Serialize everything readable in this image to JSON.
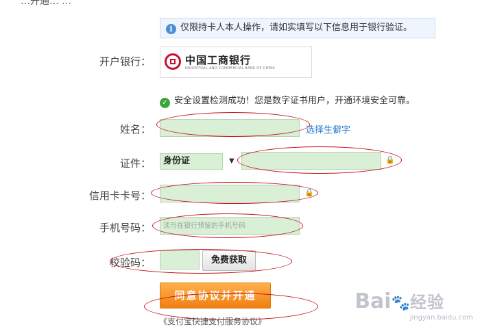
{
  "header_cut": {
    "text": "…开通…",
    "link": "…"
  },
  "notice": {
    "icon": "info-icon",
    "glyph": "i",
    "text": "仅限持卡人本人操作，请如实填写以下信息用于银行验证。"
  },
  "bank": {
    "label": "开户银行：",
    "name": "中国工商银行",
    "name_en": "INDUSTRIAL AND COMMERCIAL BANK OF CHINA"
  },
  "security": {
    "icon": "check-icon",
    "glyph": "✓",
    "text": "安全设置检测成功！您是数字证书用户，开通环境安全可靠。"
  },
  "form": {
    "name": {
      "label": "姓名：",
      "value": "",
      "link": "选择生僻字"
    },
    "id": {
      "label": "证件：",
      "type_value": "身份证",
      "caret": "▼",
      "value": "",
      "lock": "🔒"
    },
    "card": {
      "label": "信用卡卡号：",
      "value": "",
      "lock": "🔒"
    },
    "phone": {
      "label": "手机号码：",
      "placeholder": "须与在银行预留的手机号码"
    },
    "code": {
      "label": "校验码：",
      "value": "",
      "button": "免费获取"
    }
  },
  "submit": {
    "label": "同意协议并开通"
  },
  "footer_cut": {
    "text": "《支付宝快捷支付服务协议》"
  },
  "watermark": {
    "brand": "Bai",
    "paw": "🐾",
    "brand2": "经验",
    "url": "jingyan.baidu.com"
  },
  "colors": {
    "accent_link": "#2a7bd0",
    "field_bg": "#d9f0d6",
    "annotation": "#c8101a",
    "button_orange": "#f08a1c"
  }
}
